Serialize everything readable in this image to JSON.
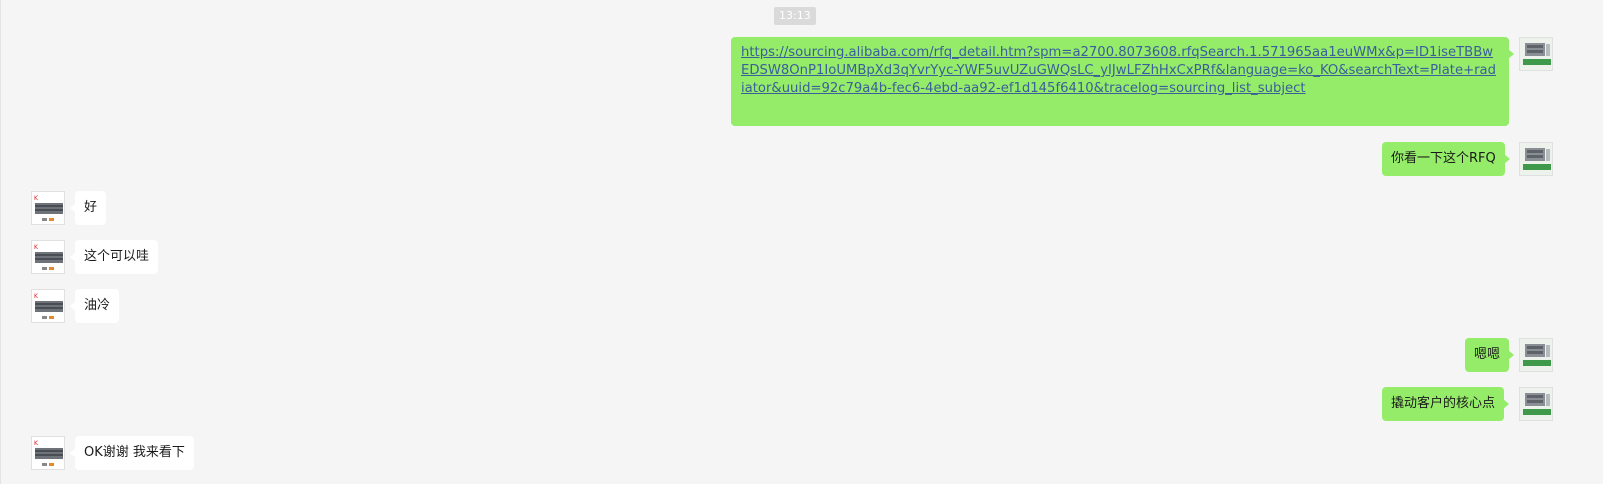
{
  "timestamp": "13:13",
  "messages": {
    "m1": {
      "link": "https://sourcing.alibaba.com/rfq_detail.htm?spm=a2700.8073608.rfqSearch.1.571965aa1euWMx&p=ID1iseTBBwEDSW8OnP1IoUMBpXd3qYvrYyc-YWF5uvUZuGWQsLC_yIJwLFZhHxCxPRf&language=ko_KO&searchText=Plate+radiator&uuid=92c79a4b-fec6-4ebd-aa92-ef1d145f6410&tracelog=sourcing_list_subject"
    },
    "m2": {
      "text": "你看一下这个RFQ"
    },
    "m3": {
      "text": "好"
    },
    "m4": {
      "text": "这个可以哇"
    },
    "m5": {
      "text": "油冷"
    },
    "m6": {
      "text": "嗯嗯"
    },
    "m7": {
      "text": "撬动客户的核心点"
    },
    "m8": {
      "text": "OK谢谢 我来看下"
    }
  },
  "colors": {
    "background": "#f5f5f5",
    "outgoing_bubble": "#95ec69",
    "incoming_bubble": "#ffffff",
    "link": "#3a5f9a"
  }
}
